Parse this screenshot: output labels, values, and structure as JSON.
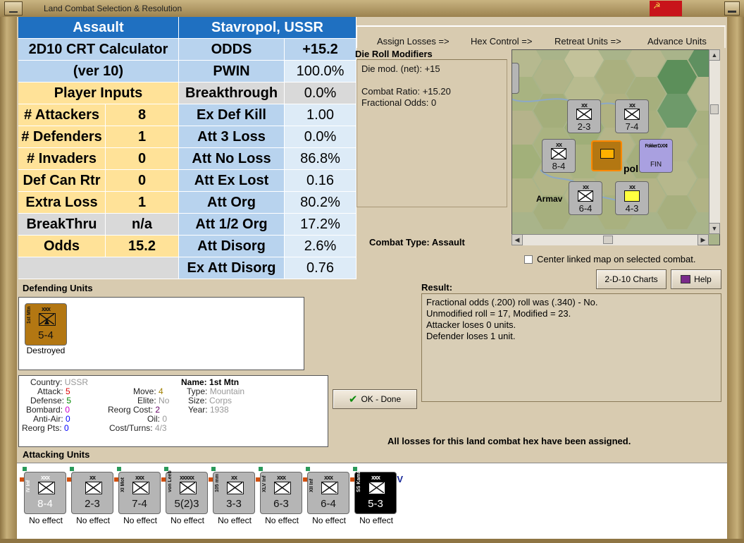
{
  "window": {
    "title": "Land Combat Selection & Resolution"
  },
  "phases": [
    "Assign Losses =>",
    "Hex Control =>",
    "Retreat Units =>",
    "Advance Units"
  ],
  "crt": {
    "header_left": "Assault",
    "header_right": "Stavropol, USSR",
    "calc_title": "2D10 CRT Calculator",
    "calc_version": "(ver 10)",
    "player_inputs": "Player Inputs",
    "inputs": [
      {
        "label": "# Attackers",
        "value": "8"
      },
      {
        "label": "# Defenders",
        "value": "1"
      },
      {
        "label": "# Invaders",
        "value": "0"
      },
      {
        "label": "Def Can Rtr",
        "value": "0"
      },
      {
        "label": "Extra Loss",
        "value": "1"
      },
      {
        "label": "BreakThru",
        "value": "n/a"
      },
      {
        "label": "Odds",
        "value": "15.2"
      }
    ],
    "outputs": [
      {
        "label": "ODDS",
        "value": "+15.2"
      },
      {
        "label": "PWIN",
        "value": "100.0%"
      },
      {
        "label": "Breakthrough",
        "value": "0.0%"
      },
      {
        "label": "Ex Def Kill",
        "value": "1.00"
      },
      {
        "label": "Att 3 Loss",
        "value": "0.0%"
      },
      {
        "label": "Att No Loss",
        "value": "86.8%"
      },
      {
        "label": "Att Ex Lost",
        "value": "0.16"
      },
      {
        "label": "Att Org",
        "value": "80.2%"
      },
      {
        "label": "Att 1/2 Org",
        "value": "17.2%"
      },
      {
        "label": "Att Disorg",
        "value": "2.6%"
      },
      {
        "label": "Ex Att Disorg",
        "value": "0.76"
      }
    ]
  },
  "die_roll": {
    "heading": "Die Roll Modifiers",
    "lines": [
      "Die mod. (net): +15",
      "",
      "Combat Ratio: +15.20",
      "Fractional Odds: 0"
    ]
  },
  "map": {
    "labels": [
      "Armav",
      "pol"
    ],
    "units": [
      {
        "size": "xx",
        "str": "2-3"
      },
      {
        "size": "xx",
        "str": "7-4",
        "name": "XI Mot"
      },
      {
        "size": "xx",
        "str": "8-4",
        "name": "IV Inf"
      },
      {
        "size": "xx",
        "str": "6-4"
      },
      {
        "size": "xx",
        "str": "4-3"
      },
      {
        "name": "Fokker D.XXI",
        "size": "FIN"
      }
    ]
  },
  "combat_type": {
    "label": "Combat Type:",
    "value": "Assault"
  },
  "center_map": {
    "label": "Center linked map on selected combat."
  },
  "buttons": {
    "charts": "2-D-10 Charts",
    "help": "Help",
    "ok": "OK - Done"
  },
  "result": {
    "heading": "Result:",
    "lines": [
      "Fractional odds (.200) roll was (.340)  - No.",
      "Unmodified roll = 17, Modified = 23.",
      "Attacker loses 0 units.",
      "Defender loses 1 unit."
    ]
  },
  "defending": {
    "heading": "Defending Units",
    "unit": {
      "size": "xxx",
      "name": "1st Mtn",
      "str": "5-4",
      "status": "Destroyed"
    }
  },
  "unit_info": {
    "country_label": "Country:",
    "country": "USSR",
    "attack_label": "Attack:",
    "attack": "5",
    "defense_label": "Defense:",
    "defense": "5",
    "bombard_label": "Bombard:",
    "bombard": "0",
    "antiair_label": "Anti-Air:",
    "antiair": "0",
    "reorg_pts_label": "Reorg Pts:",
    "reorg_pts": "0",
    "move_label": "Move:",
    "move": "4",
    "elite_label": "Elite:",
    "elite": "No",
    "reorg_cost_label": "Reorg Cost:",
    "reorg_cost": "2",
    "oil_label": "Oil:",
    "oil": "0",
    "cost_label": "Cost/Turns:",
    "cost": "4/3",
    "name_label": "Name:",
    "name": "1st Mtn",
    "type_label": "Type:",
    "type": "Mountain",
    "size_label": "Size:",
    "size": "Corps",
    "year_label": "Year:",
    "year": "1938"
  },
  "losses_msg": "All losses for this land combat hex have been assigned.",
  "attacking": {
    "heading": "Attacking Units",
    "units": [
      {
        "size": "xxx",
        "name": "IV Inf",
        "str": "8-4",
        "status": "No effect",
        "style": "light"
      },
      {
        "size": "xx",
        "name": "",
        "str": "2-3",
        "status": "No effect",
        "style": ""
      },
      {
        "size": "xxx",
        "name": "XI Mot",
        "str": "7-4",
        "status": "No effect",
        "style": ""
      },
      {
        "size": "xxxxx",
        "name": "von Leeb",
        "str": "5(2)3",
        "status": "No effect",
        "style": ""
      },
      {
        "size": "xx",
        "name": "105 mm",
        "str": "3-3",
        "status": "No effect",
        "style": ""
      },
      {
        "size": "xxx",
        "name": "XLV Inf",
        "str": "6-3",
        "status": "No effect",
        "style": ""
      },
      {
        "size": "xxx",
        "name": "XII Inf",
        "str": "6-4",
        "status": "No effect",
        "style": ""
      },
      {
        "size": "xxx",
        "name": "SS Kama",
        "str": "5-3",
        "status": "No effect",
        "style": "dark",
        "badge": "V"
      }
    ]
  },
  "colors": {
    "header_blue": "#1f70c1",
    "crt_blue": "#b8d3ee",
    "crt_tan": "#ffe298",
    "crt_grey": "#d9d9d9",
    "panel_bg": "#d8cbb0",
    "soviet_red": "#c8141a",
    "axis_grey": "#b5b5b5",
    "soviet_brown": "#b37712"
  }
}
